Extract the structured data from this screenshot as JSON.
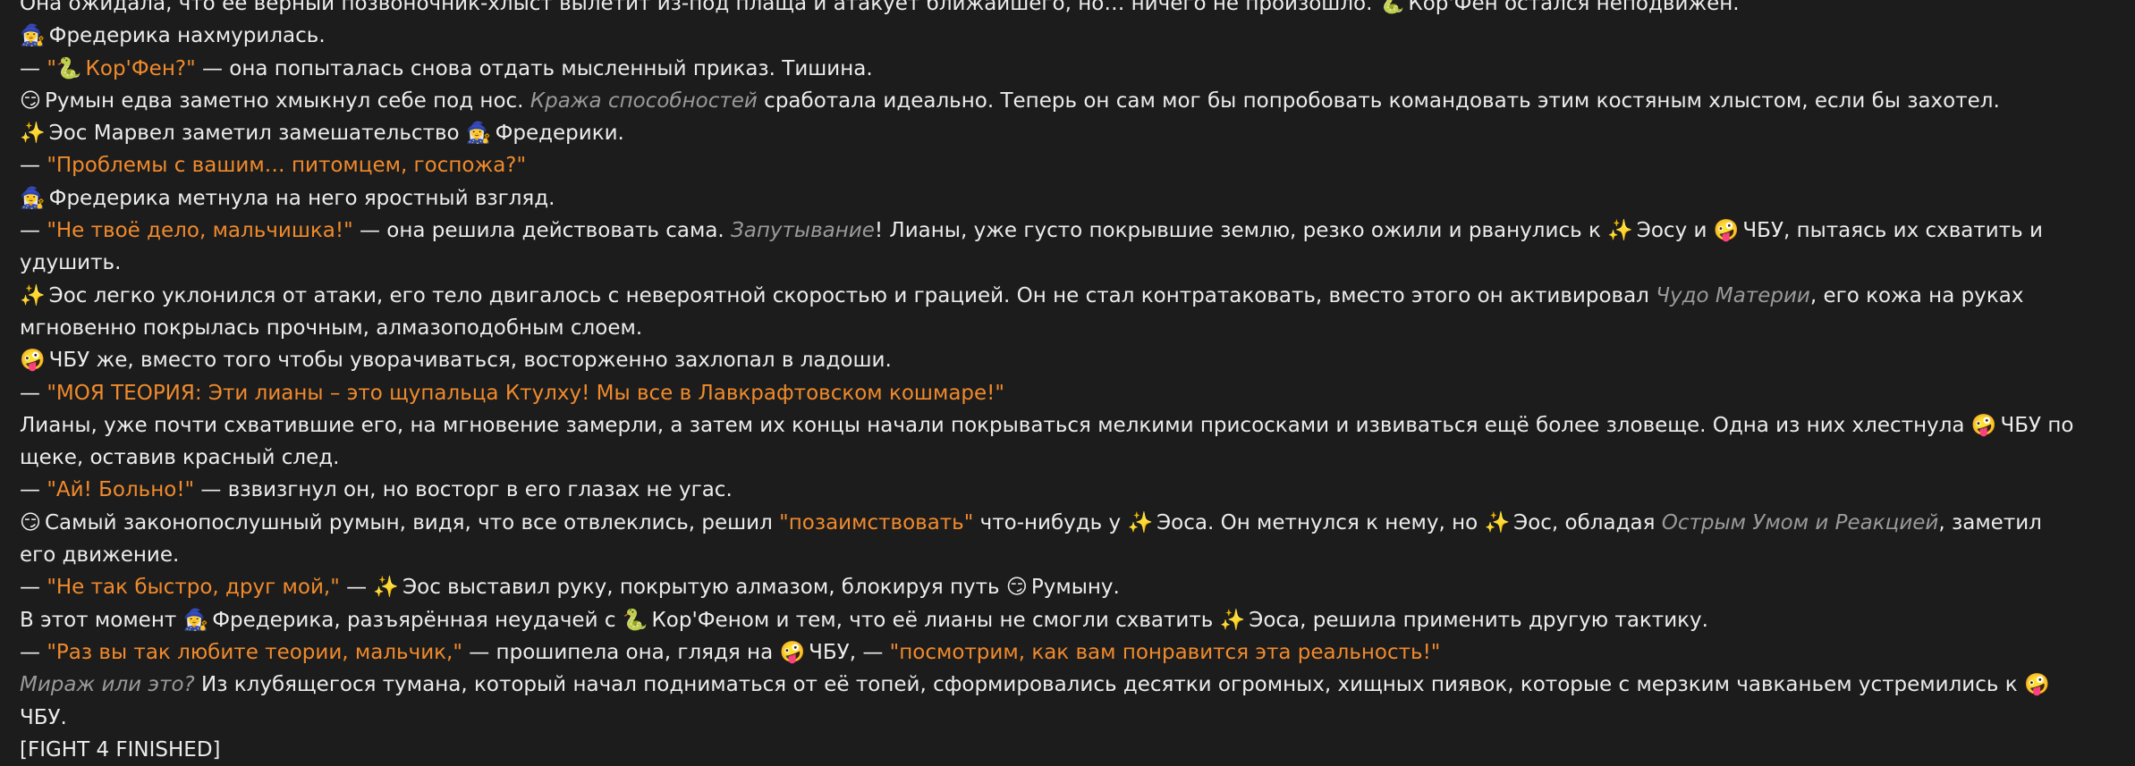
{
  "message": {
    "lines": [
      [
        {
          "k": "t",
          "v": "Она ожидала, что её верный позвоночник-хлыст вылетит из-под плаща и атакует ближайшего, но… ничего не произошло. "
        },
        {
          "k": "e",
          "v": "🐍"
        },
        {
          "k": "t",
          "v": "Кор'Фен остался неподвижен."
        }
      ],
      [
        {
          "k": "e",
          "v": "🧙‍♀️"
        },
        {
          "k": "t",
          "v": "Фредерика нахмурилась."
        }
      ],
      [
        {
          "k": "t",
          "v": "— "
        },
        {
          "k": "q",
          "v": "\""
        },
        {
          "k": "e",
          "v": "🐍"
        },
        {
          "k": "q",
          "v": "Кор'Фен?\""
        },
        {
          "k": "t",
          "v": " — она попыталась снова отдать мысленный приказ. Тишина."
        }
      ],
      [
        {
          "k": "e",
          "v": "😏"
        },
        {
          "k": "t",
          "v": "Румын едва заметно хмыкнул себе под нос. "
        },
        {
          "k": "i",
          "v": "Кража способностей"
        },
        {
          "k": "t",
          "v": " сработала идеально. Теперь он сам мог бы попробовать командовать этим костяным хлыстом, если бы захотел."
        }
      ],
      [
        {
          "k": "e",
          "v": "✨"
        },
        {
          "k": "t",
          "v": "Эос Марвел заметил замешательство "
        },
        {
          "k": "e",
          "v": "🧙‍♀️"
        },
        {
          "k": "t",
          "v": "Фредерики."
        }
      ],
      [
        {
          "k": "t",
          "v": "— "
        },
        {
          "k": "q",
          "v": "\"Проблемы с вашим… питомцем, госпожа?\""
        }
      ],
      [
        {
          "k": "e",
          "v": "🧙‍♀️"
        },
        {
          "k": "t",
          "v": "Фредерика метнула на него яростный взгляд."
        }
      ],
      [
        {
          "k": "t",
          "v": "— "
        },
        {
          "k": "q",
          "v": "\"Не твоё дело, мальчишка!\""
        },
        {
          "k": "t",
          "v": " — она решила действовать сама. "
        },
        {
          "k": "i",
          "v": "Запутывание"
        },
        {
          "k": "t",
          "v": "! Лианы, уже густо покрывшие землю, резко ожили и рванулись к "
        },
        {
          "k": "e",
          "v": "✨"
        },
        {
          "k": "t",
          "v": "Эосу и "
        },
        {
          "k": "e",
          "v": "🤪"
        },
        {
          "k": "t",
          "v": "ЧБУ, пытаясь их схватить и удушить."
        }
      ],
      [
        {
          "k": "e",
          "v": "✨"
        },
        {
          "k": "t",
          "v": "Эос легко уклонился от атаки, его тело двигалось с невероятной скоростью и грацией. Он не стал контратаковать, вместо этого он активировал "
        },
        {
          "k": "i",
          "v": "Чудо Материи"
        },
        {
          "k": "t",
          "v": ", его кожа на руках мгновенно покрылась прочным, алмазоподобным слоем."
        }
      ],
      [
        {
          "k": "e",
          "v": "🤪"
        },
        {
          "k": "t",
          "v": "ЧБУ же, вместо того чтобы уворачиваться, восторженно захлопал в ладоши."
        }
      ],
      [
        {
          "k": "t",
          "v": "— "
        },
        {
          "k": "q",
          "v": "\"МОЯ ТЕОРИЯ: Эти лианы – это щупальца Ктулху! Мы все в Лавкрафтовском кошмаре!\""
        }
      ],
      [
        {
          "k": "t",
          "v": "Лианы, уже почти схватившие его, на мгновение замерли, а затем их концы начали покрываться мелкими присосками и извиваться ещё более зловеще. Одна из них хлестнула "
        },
        {
          "k": "e",
          "v": "🤪"
        },
        {
          "k": "t",
          "v": "ЧБУ по щеке, оставив красный след."
        }
      ],
      [
        {
          "k": "t",
          "v": "— "
        },
        {
          "k": "q",
          "v": "\"Ай! Больно!\""
        },
        {
          "k": "t",
          "v": " — взвизгнул он, но восторг в его глазах не угас."
        }
      ],
      [
        {
          "k": "e",
          "v": "😏"
        },
        {
          "k": "t",
          "v": "Самый законопослушный румын, видя, что все отвлеклись, решил "
        },
        {
          "k": "q",
          "v": "\"позаимствовать\""
        },
        {
          "k": "t",
          "v": " что-нибудь у "
        },
        {
          "k": "e",
          "v": "✨"
        },
        {
          "k": "t",
          "v": "Эоса. Он метнулся к нему, но "
        },
        {
          "k": "e",
          "v": "✨"
        },
        {
          "k": "t",
          "v": "Эос, обладая "
        },
        {
          "k": "i",
          "v": "Острым Умом и Реакцией"
        },
        {
          "k": "t",
          "v": ", заметил его движение."
        }
      ],
      [
        {
          "k": "t",
          "v": "— "
        },
        {
          "k": "q",
          "v": "\"Не так быстро, друг мой,\""
        },
        {
          "k": "t",
          "v": " — "
        },
        {
          "k": "e",
          "v": "✨"
        },
        {
          "k": "t",
          "v": "Эос выставил руку, покрытую алмазом, блокируя путь "
        },
        {
          "k": "e",
          "v": "😏"
        },
        {
          "k": "t",
          "v": "Румыну."
        }
      ],
      [
        {
          "k": "t",
          "v": "В этот момент "
        },
        {
          "k": "e",
          "v": "🧙‍♀️"
        },
        {
          "k": "t",
          "v": "Фредерика, разъярённая неудачей с "
        },
        {
          "k": "e",
          "v": "🐍"
        },
        {
          "k": "t",
          "v": "Кор'Феном и тем, что её лианы не смогли схватить "
        },
        {
          "k": "e",
          "v": "✨"
        },
        {
          "k": "t",
          "v": "Эоса, решила применить другую тактику."
        }
      ],
      [
        {
          "k": "t",
          "v": "— "
        },
        {
          "k": "q",
          "v": "\"Раз вы так любите теории, мальчик,\""
        },
        {
          "k": "t",
          "v": " — прошипела она, глядя на "
        },
        {
          "k": "e",
          "v": "🤪"
        },
        {
          "k": "t",
          "v": "ЧБУ, — "
        },
        {
          "k": "q",
          "v": "\"посмотрим, как вам понравится эта реальность!\""
        }
      ],
      [
        {
          "k": "i",
          "v": "Мираж или это?"
        },
        {
          "k": "t",
          "v": " Из клубящегося тумана, который начал подниматься от её топей, сформировались десятки огромных, хищных пиявок, которые с мерзким чавканьем устремились к "
        },
        {
          "k": "e",
          "v": "🤪"
        },
        {
          "k": "t",
          "v": "ЧБУ."
        }
      ],
      [
        {
          "k": "t",
          "v": "[FIGHT 4 FINISHED]"
        }
      ]
    ]
  }
}
